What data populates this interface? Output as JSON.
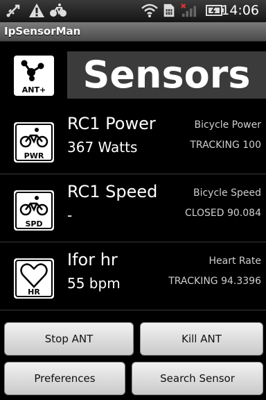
{
  "status_bar": {
    "time": "14:06",
    "icons": [
      "usb-icon",
      "warning-icon",
      "bicycle-icon",
      "wifi-icon",
      "sim-card-icon",
      "signal-icon",
      "battery-icon"
    ]
  },
  "app": {
    "title": "IpSensorMan"
  },
  "header": {
    "logo_label": "ANT+",
    "title": "Sensors"
  },
  "sensors": [
    {
      "name": "RC1 Power",
      "value": "367 Watts",
      "type": "Bicycle Power",
      "status": "TRACKING 100",
      "icon_label": "PWR",
      "icon": "bicycle-power-icon"
    },
    {
      "name": "RC1 Speed",
      "value": "-",
      "type": "Bicycle Speed",
      "status": "CLOSED 90.084",
      "icon_label": "SPD",
      "icon": "bicycle-speed-icon"
    },
    {
      "name": "Ifor hr",
      "value": "55 bpm",
      "type": "Heart Rate",
      "status": "TRACKING 94.3396",
      "icon_label": "HR",
      "icon": "heart-rate-icon"
    }
  ],
  "buttons": {
    "stop_ant": "Stop ANT",
    "kill_ant": "Kill ANT",
    "preferences": "Preferences",
    "search_sensor": "Search Sensor"
  }
}
